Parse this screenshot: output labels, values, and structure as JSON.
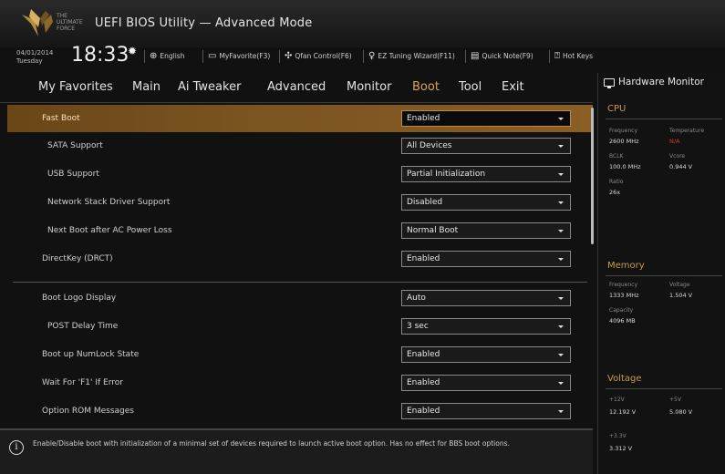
{
  "title": {
    "brand_line1": "THE ULTIMATE",
    "brand_line2": "FORCE",
    "app_title": "UEFI BIOS Utility — Advanced Mode"
  },
  "status": {
    "date": "04/01/2014",
    "day": "Tuesday",
    "time": "18:33",
    "items": [
      {
        "icon": "globe-icon",
        "label": "English"
      },
      {
        "icon": "favorites-icon",
        "label": "MyFavorite(F3)"
      },
      {
        "icon": "fan-icon",
        "label": "Qfan Control(F6)"
      },
      {
        "icon": "bulb-icon",
        "label": "EZ Tuning Wizard(F11)"
      },
      {
        "icon": "note-icon",
        "label": "Quick Note(F9)"
      },
      {
        "icon": "keyboard-icon",
        "label": "Hot Keys"
      }
    ]
  },
  "nav": {
    "tabs": [
      "My Favorites",
      "Main",
      "Ai Tweaker",
      "Advanced",
      "Monitor",
      "Boot",
      "Tool",
      "Exit"
    ],
    "active": "Boot"
  },
  "settings": [
    {
      "label": "Fast Boot",
      "value": "Enabled",
      "indent": false,
      "selected": true
    },
    {
      "label": "SATA Support",
      "value": "All Devices",
      "indent": true
    },
    {
      "label": "USB Support",
      "value": "Partial Initialization",
      "indent": true
    },
    {
      "label": "Network Stack Driver Support",
      "value": "Disabled",
      "indent": true
    },
    {
      "label": "Next Boot after AC Power Loss",
      "value": "Normal Boot",
      "indent": true
    },
    {
      "label": "DirectKey (DRCT)",
      "value": "Enabled",
      "indent": false
    },
    {
      "label": "Boot Logo Display",
      "value": "Auto",
      "indent": false
    },
    {
      "label": "POST Delay Time",
      "value": "3 sec",
      "indent": true
    },
    {
      "label": "Boot up NumLock State",
      "value": "Enabled",
      "indent": false
    },
    {
      "label": "Wait For 'F1' If Error",
      "value": "Enabled",
      "indent": false
    },
    {
      "label": "Option ROM Messages",
      "value": "Enabled",
      "indent": false
    }
  ],
  "info": {
    "text": "Enable/Disable boot with initialization of a minimal set of devices required to launch active boot option. Has no effect for BBS boot options."
  },
  "hardware_monitor": {
    "title": "Hardware Monitor",
    "cpu": {
      "heading": "CPU",
      "frequency_label": "Frequency",
      "frequency": "2600 MHz",
      "temperature_label": "Temperature",
      "temperature": "N/A",
      "bclk_label": "BCLK",
      "bclk": "100.0 MHz",
      "vcore_label": "Vcore",
      "vcore": "0.944 V",
      "ratio_label": "Ratio",
      "ratio": "26x"
    },
    "memory": {
      "heading": "Memory",
      "frequency_label": "Frequency",
      "frequency": "1333 MHz",
      "voltage_label": "Voltage",
      "voltage": "1.504 V",
      "capacity_label": "Capacity",
      "capacity": "4096 MB"
    },
    "voltage": {
      "heading": "Voltage",
      "v12_label": "+12V",
      "v12": "12.192 V",
      "v5_label": "+5V",
      "v5": "5.080 V",
      "v33_label": "+3.3V",
      "v33": "3.312 V"
    }
  },
  "colors": {
    "accent": "#c79a4a",
    "selected_row": "#7a531f",
    "temperature_na": "#d23a3a"
  }
}
